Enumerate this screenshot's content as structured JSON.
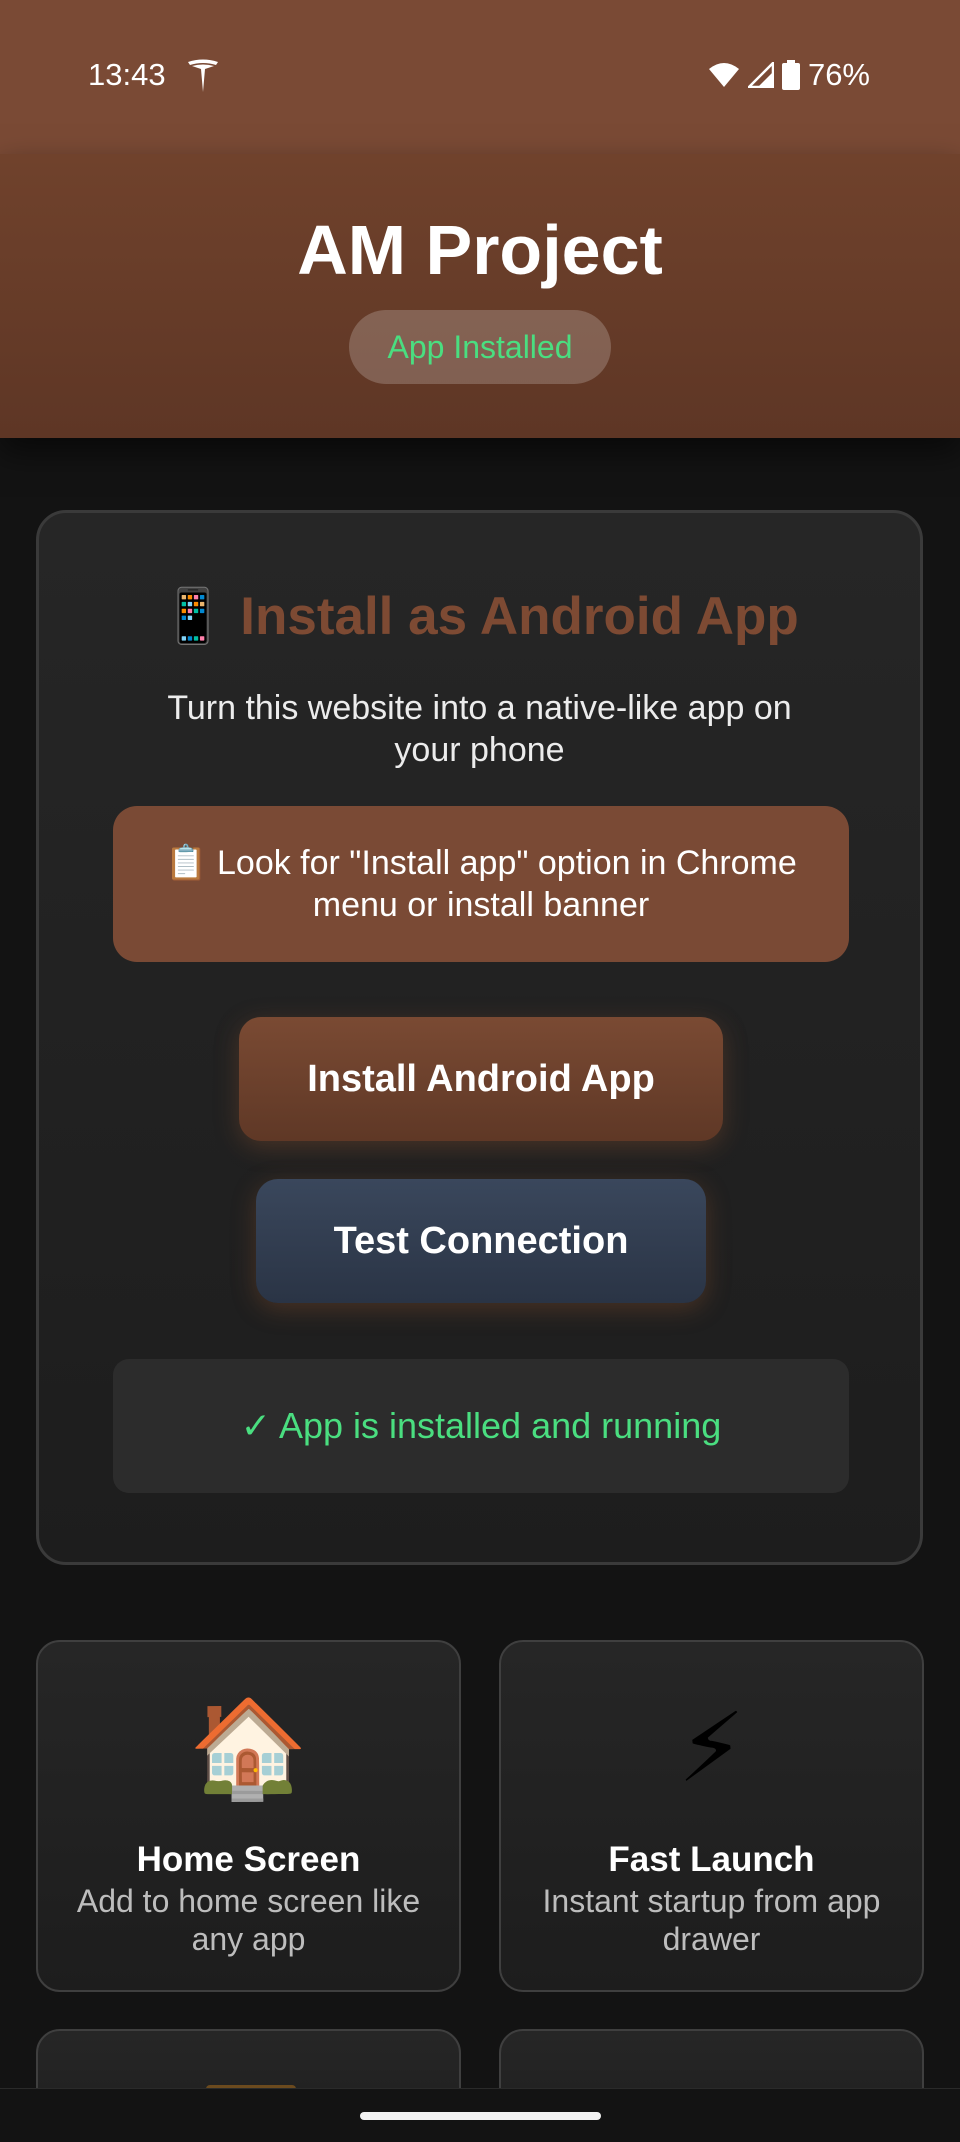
{
  "status_bar": {
    "time": "13:43",
    "battery": "76%",
    "icons": [
      "tesla-icon",
      "wifi-icon",
      "signal-icon",
      "battery-icon"
    ]
  },
  "header": {
    "title": "AM Project",
    "badge": "App Installed"
  },
  "install_card": {
    "icon": "📱",
    "title": "Install as Android App",
    "description": "Turn this website into a native-like app on your phone",
    "instruction_icon": "📋",
    "instruction": "Look for \"Install app\" option in Chrome menu or install banner",
    "install_button": "Install Android App",
    "test_button": "Test Connection",
    "status_icon": "✓",
    "status_text": "App is installed and running"
  },
  "features": [
    {
      "icon": "🏠",
      "title": "Home Screen",
      "description": "Add to home screen like any app"
    },
    {
      "icon": "⚡",
      "title": "Fast Launch",
      "description": "Instant startup from app drawer"
    }
  ],
  "colors": {
    "accent": "#7a4a35",
    "success": "#4ade80",
    "background": "#131313"
  }
}
